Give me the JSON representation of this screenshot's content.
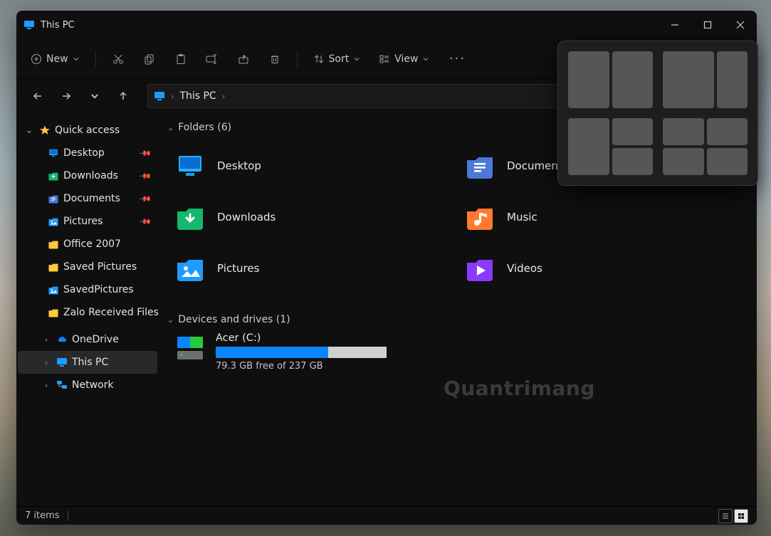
{
  "title": "This PC",
  "toolbar": {
    "new_label": "New",
    "sort_label": "Sort",
    "view_label": "View"
  },
  "breadcrumb": {
    "label": "This PC"
  },
  "sidebar": {
    "quick_access": "Quick access",
    "items": [
      {
        "label": "Desktop",
        "icon": "desktop",
        "pinned": true
      },
      {
        "label": "Downloads",
        "icon": "downloads",
        "pinned": true
      },
      {
        "label": "Documents",
        "icon": "documents",
        "pinned": true
      },
      {
        "label": "Pictures",
        "icon": "pictures",
        "pinned": true
      },
      {
        "label": "Office 2007",
        "icon": "folder",
        "pinned": false
      },
      {
        "label": "Saved Pictures",
        "icon": "folder",
        "pinned": false
      },
      {
        "label": "SavedPictures",
        "icon": "pictures",
        "pinned": false
      },
      {
        "label": "Zalo Received Files",
        "icon": "folder",
        "pinned": false
      }
    ],
    "onedrive": "OneDrive",
    "this_pc": "This PC",
    "network": "Network"
  },
  "groups": {
    "folders_label": "Folders (6)",
    "drives_label": "Devices and drives (1)"
  },
  "folders": [
    {
      "label": "Desktop",
      "icon": "desktop"
    },
    {
      "label": "Documents",
      "icon": "documents"
    },
    {
      "label": "Downloads",
      "icon": "downloads"
    },
    {
      "label": "Music",
      "icon": "music"
    },
    {
      "label": "Pictures",
      "icon": "pictures"
    },
    {
      "label": "Videos",
      "icon": "videos"
    }
  ],
  "drive": {
    "name": "Acer (C:)",
    "free_text": "79.3 GB free of 237 GB",
    "used_pct": 66
  },
  "status": {
    "items": "7 items"
  },
  "watermark": "Quantrimang"
}
